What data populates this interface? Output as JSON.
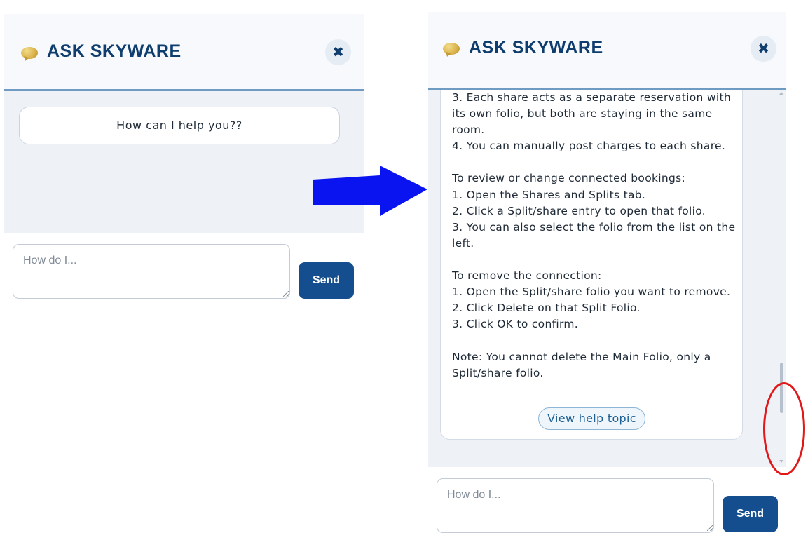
{
  "chat": {
    "title": "ASK SKYWARE",
    "close_label": "✖",
    "input_placeholder": "How do I...",
    "send_label": "Send"
  },
  "before": {
    "greeting": "How can I help you??"
  },
  "after": {
    "answer_text": "3. Each share acts as a separate reservation with its own folio, but both are staying in the same room.\n4. You can manually post charges to each share.\n\nTo review or change connected bookings:\n1. Open the Shares and Splits tab.\n2. Click a Split/share entry to open that folio.\n3. You can also select the folio from the list on the left.\n\nTo remove the connection:\n1. Open the Split/share folio you want to remove.\n2. Click Delete on that Split Folio.\n3. Click OK to confirm.\n\nNote: You cannot delete the Main Folio, only a Split/share folio.",
    "view_help_label": "View help topic",
    "scroll_fraction": 0.85
  },
  "colors": {
    "brand_navy": "#0e3d6e",
    "send_button": "#154e8e",
    "header_border": "#6f9bc2",
    "arrow": "#0a14f0",
    "highlight": "#e21818"
  },
  "icons": {
    "logo": "speech-bubble-icon",
    "close": "close-icon",
    "annotation_arrow": "right-arrow-icon"
  }
}
